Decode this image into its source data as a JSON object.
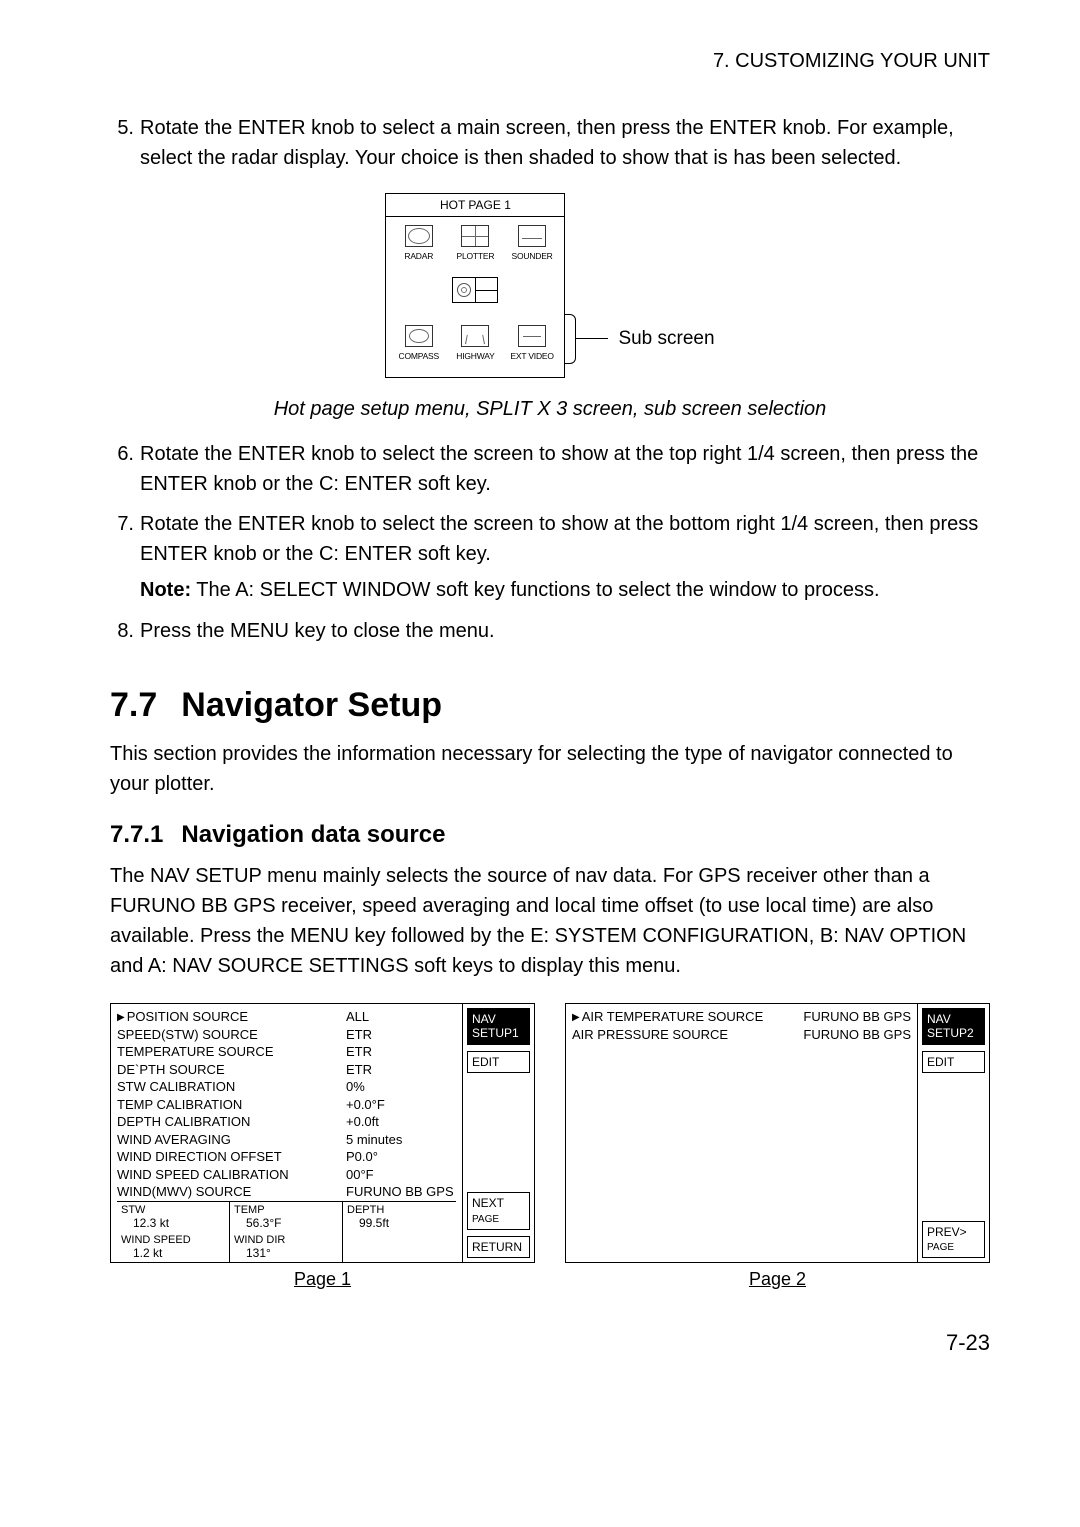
{
  "header": "7. CUSTOMIZING YOUR UNIT",
  "steps": {
    "s5": {
      "n": "5.",
      "t": "Rotate the ENTER knob to select a main screen, then press the ENTER knob. For example, select the radar display. Your choice is then shaded to show that is has been selected."
    },
    "s6": {
      "n": "6.",
      "t": "Rotate the ENTER knob to select the screen to show at the top right 1/4 screen, then press the ENTER knob or the C: ENTER soft key."
    },
    "s7": {
      "n": "7.",
      "t": "Rotate the ENTER knob to select the screen to show at the bottom right 1/4 screen, then press ENTER knob or the C: ENTER soft key."
    },
    "s8": {
      "n": "8.",
      "t": "Press the MENU key to close the menu."
    }
  },
  "hotpage": {
    "title": "HOT PAGE 1",
    "row1": {
      "radar": "RADAR",
      "plotter": "PLOTTER",
      "sounder": "SOUNDER"
    },
    "row2": {
      "compass": "COMPASS",
      "highway": "HIGHWAY",
      "extvideo": "EXT VIDEO"
    },
    "sub_label": "Sub screen"
  },
  "caption1": "Hot page setup menu, SPLIT X 3 screen, sub screen selection",
  "note_bold": "Note:",
  "note_rest": " The A: SELECT WINDOW soft key functions to select the window to process.",
  "section": {
    "num": "7.7",
    "title": "Navigator Setup"
  },
  "section_intro": "This section provides the information necessary for selecting the type of navigator connected to your plotter.",
  "subsection": {
    "num": "7.7.1",
    "title": "Navigation data source"
  },
  "subsection_body": "The NAV SETUP menu mainly selects the source of nav data. For GPS receiver other than a FURUNO BB GPS receiver, speed averaging and local time offset (to use local time) are also available. Press the MENU key followed by the E: SYSTEM CONFIGURATION, B: NAV OPTION and A: NAV SOURCE SETTINGS soft keys to display this menu.",
  "nav1": {
    "rows": [
      {
        "k": "POSITION SOURCE",
        "v": "ALL",
        "p": true
      },
      {
        "k": "SPEED(STW) SOURCE",
        "v": "ETR"
      },
      {
        "k": "TEMPERATURE SOURCE",
        "v": "ETR"
      },
      {
        "k": "DE`PTH SOURCE",
        "v": "ETR"
      },
      {
        "k": "STW CALIBRATION",
        "v": "0%"
      },
      {
        "k": "TEMP CALIBRATION",
        "v": "+0.0°F"
      },
      {
        "k": "DEPTH CALIBRATION",
        "v": "+0.0ft"
      },
      {
        "k": "WIND AVERAGING",
        "v": "5 minutes"
      },
      {
        "k": "WIND DIRECTION OFFSET",
        "v": "P0.0°"
      },
      {
        "k": "WIND SPEED CALIBRATION",
        "v": "00°F"
      },
      {
        "k": "WIND(MWV) SOURCE",
        "v": "FURUNO BB GPS"
      }
    ],
    "status": {
      "a": {
        "lbl": "STW",
        "val": "12.3 kt"
      },
      "b": {
        "lbl": "TEMP",
        "val": "56.3°F"
      },
      "c": {
        "lbl": "DEPTH",
        "val": "99.5ft"
      },
      "d": {
        "lbl": "WIND SPEED",
        "val": "1.2 kt"
      },
      "e": {
        "lbl": "WIND DIR",
        "val": "131°"
      }
    },
    "soft": {
      "title1": "NAV",
      "title2": "SETUP1",
      "edit": "EDIT",
      "next1": "NEXT",
      "next2": "PAGE",
      "return": "RETURN"
    },
    "caption": "Page 1"
  },
  "nav2": {
    "rows": [
      {
        "k": "AIR TEMPERATURE SOURCE",
        "v": "FURUNO BB GPS",
        "p": true
      },
      {
        "k": "AIR PRESSURE SOURCE",
        "v": "FURUNO BB GPS"
      }
    ],
    "soft": {
      "title1": "NAV",
      "title2": "SETUP2",
      "edit": "EDIT",
      "prev1": "PREV>",
      "prev2": "PAGE"
    },
    "caption": "Page 2"
  },
  "footer": "7-23"
}
